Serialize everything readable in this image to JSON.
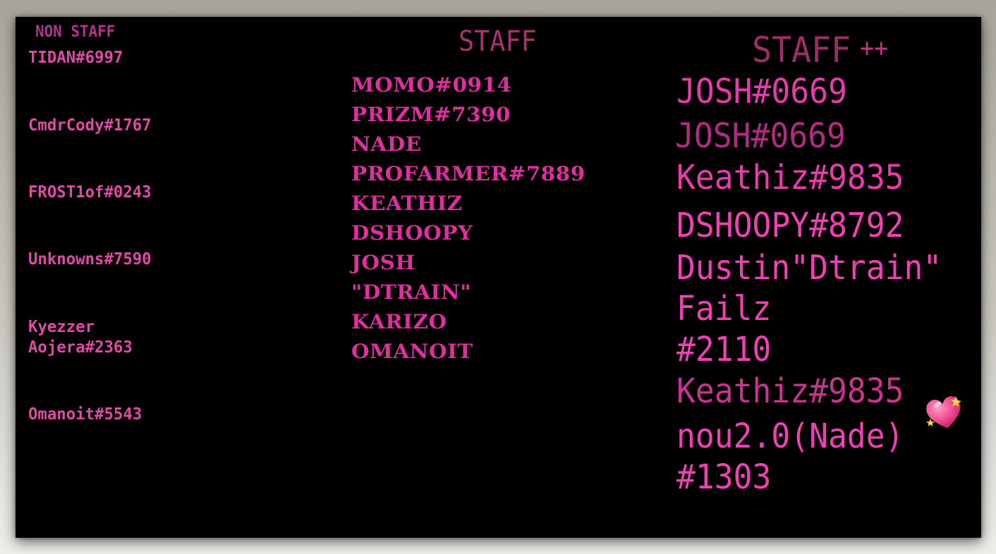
{
  "headers": {
    "non_staff": "NON STAFF",
    "staff": "STAFF",
    "staff_plus": "STAFF",
    "staff_plus_suffix": "++"
  },
  "non_staff": [
    "TIDAN#6997",
    "CmdrCody#1767",
    "FROST1of#0243",
    "Unknowns#7590",
    "Kyezzer",
    "Aojera#2363",
    "Omanoit#5543"
  ],
  "staff": [
    "MOMO#0914",
    "PRIZM#7390",
    "NADE",
    "PROFARMER#7889",
    "KEATHIZ",
    "DSHOOPY",
    "JOSH",
    "\"DTRAIN\"",
    "KARIZO",
    "OMANOIT"
  ],
  "staff_plus": [
    "JOSH#0669",
    "JOSH#0669",
    "Keathiz#9835",
    "DSHOOPY#8792",
    "Dustin\"Dtrain\"",
    "Failz",
    "#2110",
    "Keathiz#9835",
    "nou2.0(Nade)",
    "#1303"
  ],
  "decorations": {
    "heart": "heart-emoji-icon"
  },
  "colors": {
    "background": "#000000",
    "frame": "#c9c6bf",
    "pink_primary": "#e02ea0",
    "pink_muted": "#a8306e"
  }
}
